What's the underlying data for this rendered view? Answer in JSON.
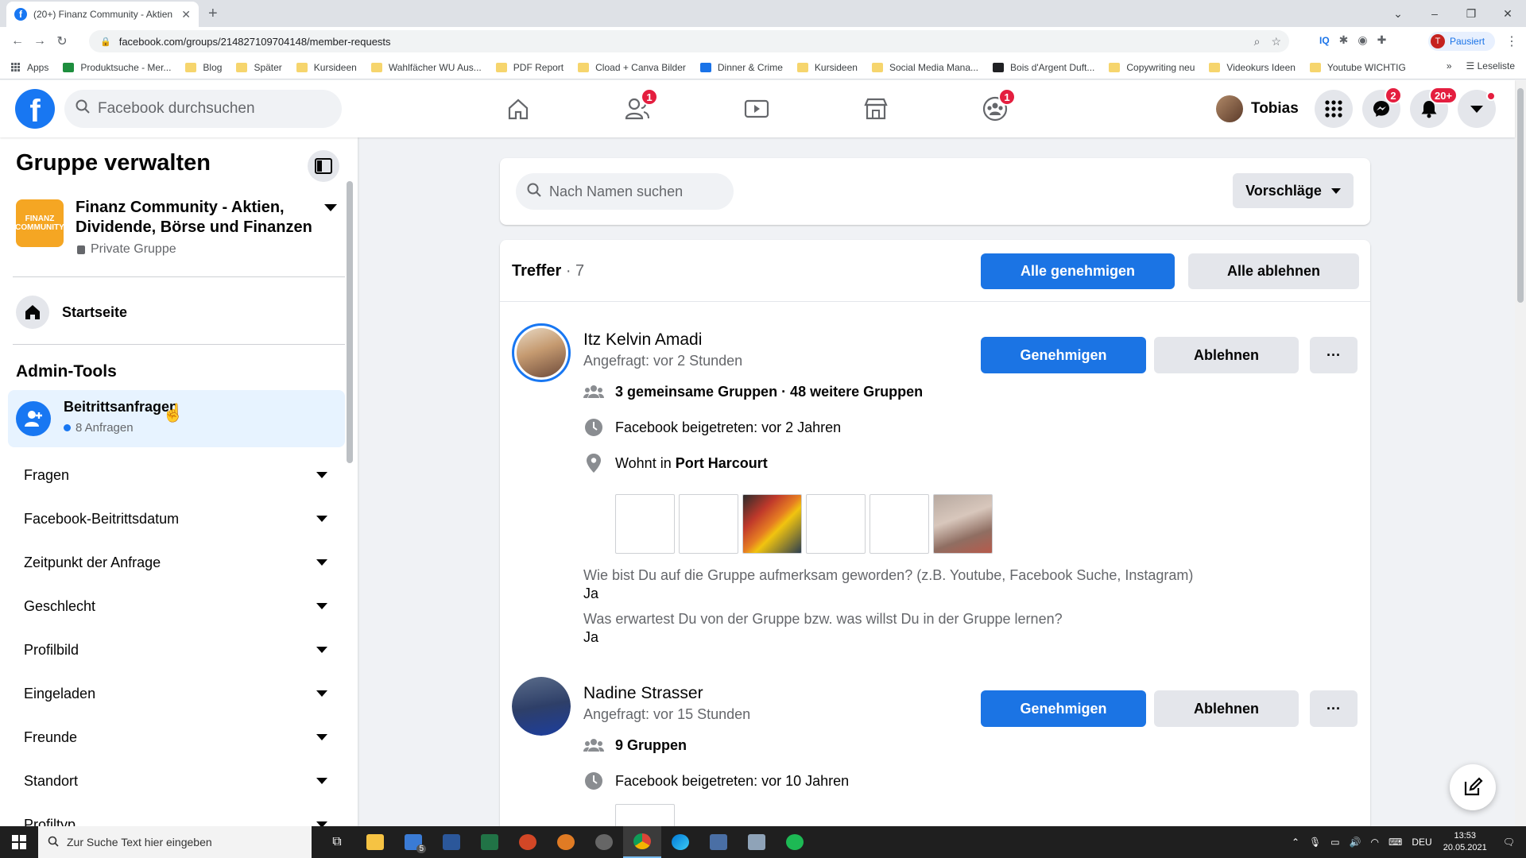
{
  "browser": {
    "tab_title": "(20+) Finanz Community - Aktien",
    "url": "facebook.com/groups/214827109704148/member-requests",
    "profile_status": "Pausiert",
    "profile_initial": "T",
    "bookmarks": [
      {
        "label": "Apps",
        "icon": "apps-grid"
      },
      {
        "label": "Produktsuche - Mer...",
        "icon": "green"
      },
      {
        "label": "Blog",
        "icon": "folder"
      },
      {
        "label": "Später",
        "icon": "folder"
      },
      {
        "label": "Kursideen",
        "icon": "folder"
      },
      {
        "label": "Wahlfächer WU Aus...",
        "icon": "folder"
      },
      {
        "label": "PDF Report",
        "icon": "folder"
      },
      {
        "label": "Cload + Canva Bilder",
        "icon": "folder"
      },
      {
        "label": "Dinner & Crime",
        "icon": "blue"
      },
      {
        "label": "Kursideen",
        "icon": "folder"
      },
      {
        "label": "Social Media Mana...",
        "icon": "folder"
      },
      {
        "label": "Bois d'Argent Duft...",
        "icon": "dark"
      },
      {
        "label": "Copywriting neu",
        "icon": "folder"
      },
      {
        "label": "Videokurs Ideen",
        "icon": "folder"
      },
      {
        "label": "Youtube WICHTIG",
        "icon": "folder"
      }
    ],
    "reading_list": "Leseliste",
    "more_bookmarks": "»"
  },
  "fb_header": {
    "logo": "f",
    "search_placeholder": "Facebook durchsuchen",
    "friends_badge": "1",
    "groups_badge": "1",
    "user_name": "Tobias",
    "messenger_badge": "2",
    "notifications_badge": "20+"
  },
  "sidebar": {
    "title": "Gruppe verwalten",
    "group_thumb_text": "FINANZ COMMUNITY",
    "group_name": "Finanz Community - Aktien, Dividende, Börse und Finanzen",
    "group_privacy": "Private Gruppe",
    "home_label": "Startseite",
    "admin_tools_heading": "Admin-Tools",
    "requests_label": "Beitrittsanfragen",
    "requests_sub": "8 Anfragen",
    "filters": [
      "Fragen",
      "Facebook-Beitrittsdatum",
      "Zeitpunkt der Anfrage",
      "Geschlecht",
      "Profilbild",
      "Eingeladen",
      "Freunde",
      "Standort",
      "Profiltyp"
    ]
  },
  "main": {
    "member_search_placeholder": "Nach Namen suchen",
    "sort_label": "Vorschläge",
    "results_label": "Treffer",
    "results_count": "· 7",
    "approve_all": "Alle genehmigen",
    "decline_all": "Alle ablehnen",
    "approve": "Genehmigen",
    "decline": "Ablehnen",
    "more": "···",
    "members": [
      {
        "name": "Itz Kelvin Amadi",
        "requested": "Angefragt: vor 2 Stunden",
        "groups": "3 gemeinsame Gruppen · 48 weitere Gruppen",
        "joined": "Facebook beigetreten: vor 2 Jahren",
        "lives_prefix": "Wohnt in",
        "lives_city": "Port Harcourt",
        "q1": "Wie bist Du auf die Gruppe aufmerksam geworden? (z.B. Youtube, Facebook Suche, Instagram)",
        "a1": "Ja",
        "q2": "Was erwartest Du von der Gruppe bzw. was willst Du in der Gruppe lernen?",
        "a2": "Ja"
      },
      {
        "name": "Nadine Strasser",
        "requested": "Angefragt: vor 15 Stunden",
        "groups": "9 Gruppen",
        "joined": "Facebook beigetreten: vor 10 Jahren"
      }
    ]
  },
  "taskbar": {
    "search_placeholder": "Zur Suche Text hier eingeben",
    "mail_badge": "5",
    "language": "DEU",
    "time": "13:53",
    "date": "20.05.2021"
  },
  "colors": {
    "fb_blue": "#1877f2",
    "button_blue": "#1b74e4",
    "badge_red": "#e41e3f",
    "sidebar_selected": "#e7f3ff"
  }
}
